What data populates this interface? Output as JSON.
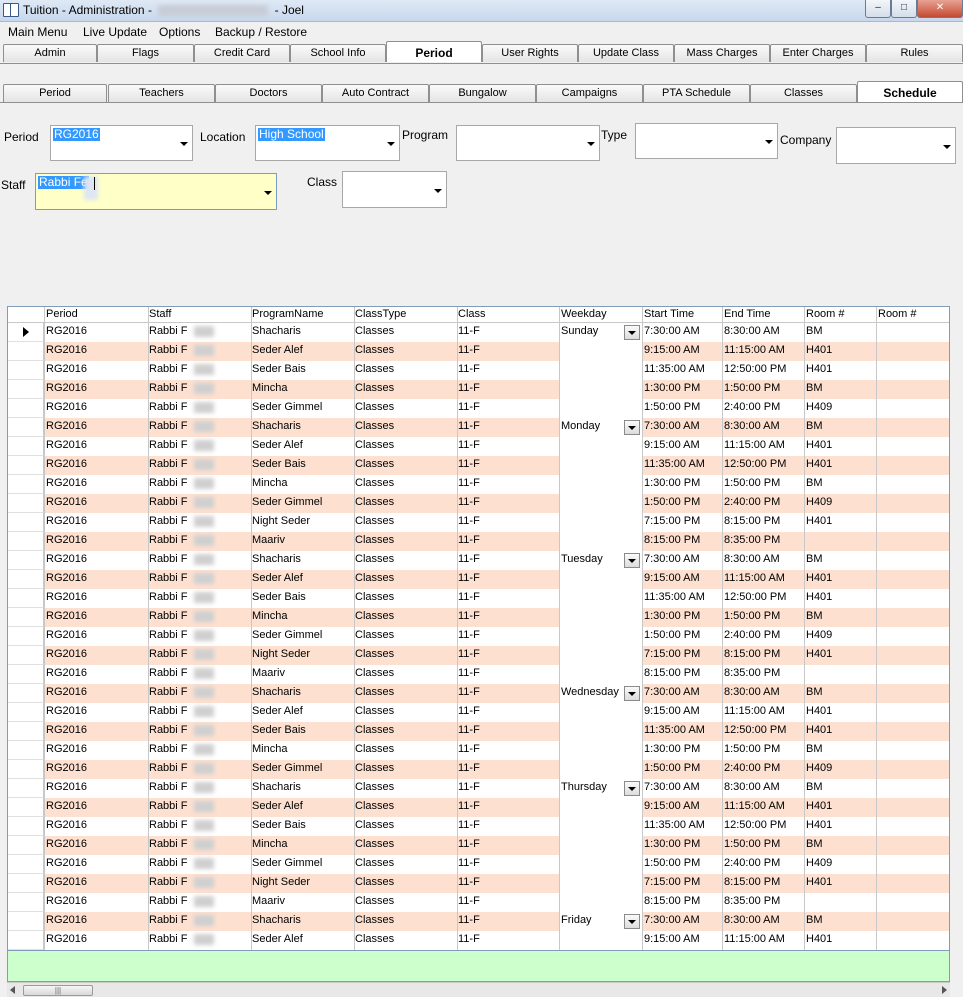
{
  "window": {
    "title_left": "Tuition - Administration - ",
    "title_right": " - Joel"
  },
  "menu": [
    "Main Menu",
    "Live Update",
    "Options",
    "Backup / Restore"
  ],
  "main_tabs": [
    "Admin",
    "Flags",
    "Credit Card",
    "School Info",
    "Period",
    "User Rights",
    "Update Class",
    "Mass Charges",
    "Enter Charges",
    "Rules"
  ],
  "main_tab_active": "Period",
  "sub_tabs": [
    "Period",
    "Teachers",
    "Doctors",
    "Auto Contract",
    "Bungalow",
    "Campaigns",
    "PTA Schedule",
    "Classes",
    "Schedule"
  ],
  "sub_tab_active": "Schedule",
  "filters": {
    "period_label": "Period",
    "period_value": "RG2016",
    "location_label": "Location",
    "location_value": "High School",
    "program_label": "Program",
    "program_value": "",
    "type_label": "Type",
    "type_value": "",
    "company_label": "Company",
    "company_value": "",
    "staff_label": "Staff",
    "staff_value": "Rabbi Fe",
    "class_label": "Class",
    "class_value": ""
  },
  "grid": {
    "columns": [
      "Period",
      "Staff",
      "ProgramName",
      "ClassType",
      "Class",
      "Weekday",
      "Start Time",
      "End Time",
      "Room #",
      "Room #"
    ],
    "rows": [
      {
        "period": "RG2016",
        "staff": "Rabbi F",
        "program": "Shacharis",
        "classtype": "Classes",
        "class": "11-F",
        "weekday": "Sunday",
        "start": "7:30:00 AM",
        "end": "8:30:00 AM",
        "room": "BM"
      },
      {
        "period": "RG2016",
        "staff": "Rabbi F",
        "program": "Seder Alef",
        "classtype": "Classes",
        "class": "11-F",
        "weekday": "",
        "start": "9:15:00 AM",
        "end": "11:15:00 AM",
        "room": "H401"
      },
      {
        "period": "RG2016",
        "staff": "Rabbi F",
        "program": "Seder Bais",
        "classtype": "Classes",
        "class": "11-F",
        "weekday": "",
        "start": "11:35:00 AM",
        "end": "12:50:00 PM",
        "room": "H401"
      },
      {
        "period": "RG2016",
        "staff": "Rabbi F",
        "program": "Mincha",
        "classtype": "Classes",
        "class": "11-F",
        "weekday": "",
        "start": "1:30:00 PM",
        "end": "1:50:00 PM",
        "room": "BM"
      },
      {
        "period": "RG2016",
        "staff": "Rabbi F",
        "program": "Seder Gimmel",
        "classtype": "Classes",
        "class": "11-F",
        "weekday": "",
        "start": "1:50:00 PM",
        "end": "2:40:00 PM",
        "room": "H409"
      },
      {
        "period": "RG2016",
        "staff": "Rabbi F",
        "program": "Shacharis",
        "classtype": "Classes",
        "class": "11-F",
        "weekday": "Monday",
        "start": "7:30:00 AM",
        "end": "8:30:00 AM",
        "room": "BM"
      },
      {
        "period": "RG2016",
        "staff": "Rabbi F",
        "program": "Seder Alef",
        "classtype": "Classes",
        "class": "11-F",
        "weekday": "",
        "start": "9:15:00 AM",
        "end": "11:15:00 AM",
        "room": "H401"
      },
      {
        "period": "RG2016",
        "staff": "Rabbi F",
        "program": "Seder Bais",
        "classtype": "Classes",
        "class": "11-F",
        "weekday": "",
        "start": "11:35:00 AM",
        "end": "12:50:00 PM",
        "room": "H401"
      },
      {
        "period": "RG2016",
        "staff": "Rabbi F",
        "program": "Mincha",
        "classtype": "Classes",
        "class": "11-F",
        "weekday": "",
        "start": "1:30:00 PM",
        "end": "1:50:00 PM",
        "room": "BM"
      },
      {
        "period": "RG2016",
        "staff": "Rabbi F",
        "program": "Seder Gimmel",
        "classtype": "Classes",
        "class": "11-F",
        "weekday": "",
        "start": "1:50:00 PM",
        "end": "2:40:00 PM",
        "room": "H409"
      },
      {
        "period": "RG2016",
        "staff": "Rabbi F",
        "program": "Night Seder",
        "classtype": "Classes",
        "class": "11-F",
        "weekday": "",
        "start": "7:15:00 PM",
        "end": "8:15:00 PM",
        "room": "H401"
      },
      {
        "period": "RG2016",
        "staff": "Rabbi F",
        "program": "Maariv",
        "classtype": "Classes",
        "class": "11-F",
        "weekday": "",
        "start": "8:15:00 PM",
        "end": "8:35:00 PM",
        "room": ""
      },
      {
        "period": "RG2016",
        "staff": "Rabbi F",
        "program": "Shacharis",
        "classtype": "Classes",
        "class": "11-F",
        "weekday": "Tuesday",
        "start": "7:30:00 AM",
        "end": "8:30:00 AM",
        "room": "BM"
      },
      {
        "period": "RG2016",
        "staff": "Rabbi F",
        "program": "Seder Alef",
        "classtype": "Classes",
        "class": "11-F",
        "weekday": "",
        "start": "9:15:00 AM",
        "end": "11:15:00 AM",
        "room": "H401"
      },
      {
        "period": "RG2016",
        "staff": "Rabbi F",
        "program": "Seder Bais",
        "classtype": "Classes",
        "class": "11-F",
        "weekday": "",
        "start": "11:35:00 AM",
        "end": "12:50:00 PM",
        "room": "H401"
      },
      {
        "period": "RG2016",
        "staff": "Rabbi F",
        "program": "Mincha",
        "classtype": "Classes",
        "class": "11-F",
        "weekday": "",
        "start": "1:30:00 PM",
        "end": "1:50:00 PM",
        "room": "BM"
      },
      {
        "period": "RG2016",
        "staff": "Rabbi F",
        "program": "Seder Gimmel",
        "classtype": "Classes",
        "class": "11-F",
        "weekday": "",
        "start": "1:50:00 PM",
        "end": "2:40:00 PM",
        "room": "H409"
      },
      {
        "period": "RG2016",
        "staff": "Rabbi F",
        "program": "Night Seder",
        "classtype": "Classes",
        "class": "11-F",
        "weekday": "",
        "start": "7:15:00 PM",
        "end": "8:15:00 PM",
        "room": "H401"
      },
      {
        "period": "RG2016",
        "staff": "Rabbi F",
        "program": "Maariv",
        "classtype": "Classes",
        "class": "11-F",
        "weekday": "",
        "start": "8:15:00 PM",
        "end": "8:35:00 PM",
        "room": ""
      },
      {
        "period": "RG2016",
        "staff": "Rabbi F",
        "program": "Shacharis",
        "classtype": "Classes",
        "class": "11-F",
        "weekday": "Wednesday",
        "start": "7:30:00 AM",
        "end": "8:30:00 AM",
        "room": "BM"
      },
      {
        "period": "RG2016",
        "staff": "Rabbi F",
        "program": "Seder Alef",
        "classtype": "Classes",
        "class": "11-F",
        "weekday": "",
        "start": "9:15:00 AM",
        "end": "11:15:00 AM",
        "room": "H401"
      },
      {
        "period": "RG2016",
        "staff": "Rabbi F",
        "program": "Seder Bais",
        "classtype": "Classes",
        "class": "11-F",
        "weekday": "",
        "start": "11:35:00 AM",
        "end": "12:50:00 PM",
        "room": "H401"
      },
      {
        "period": "RG2016",
        "staff": "Rabbi F",
        "program": "Mincha",
        "classtype": "Classes",
        "class": "11-F",
        "weekday": "",
        "start": "1:30:00 PM",
        "end": "1:50:00 PM",
        "room": "BM"
      },
      {
        "period": "RG2016",
        "staff": "Rabbi F",
        "program": "Seder Gimmel",
        "classtype": "Classes",
        "class": "11-F",
        "weekday": "",
        "start": "1:50:00 PM",
        "end": "2:40:00 PM",
        "room": "H409"
      },
      {
        "period": "RG2016",
        "staff": "Rabbi F",
        "program": "Shacharis",
        "classtype": "Classes",
        "class": "11-F",
        "weekday": "Thursday",
        "start": "7:30:00 AM",
        "end": "8:30:00 AM",
        "room": "BM"
      },
      {
        "period": "RG2016",
        "staff": "Rabbi F",
        "program": "Seder Alef",
        "classtype": "Classes",
        "class": "11-F",
        "weekday": "",
        "start": "9:15:00 AM",
        "end": "11:15:00 AM",
        "room": "H401"
      },
      {
        "period": "RG2016",
        "staff": "Rabbi F",
        "program": "Seder Bais",
        "classtype": "Classes",
        "class": "11-F",
        "weekday": "",
        "start": "11:35:00 AM",
        "end": "12:50:00 PM",
        "room": "H401"
      },
      {
        "period": "RG2016",
        "staff": "Rabbi F",
        "program": "Mincha",
        "classtype": "Classes",
        "class": "11-F",
        "weekday": "",
        "start": "1:30:00 PM",
        "end": "1:50:00 PM",
        "room": "BM"
      },
      {
        "period": "RG2016",
        "staff": "Rabbi F",
        "program": "Seder Gimmel",
        "classtype": "Classes",
        "class": "11-F",
        "weekday": "",
        "start": "1:50:00 PM",
        "end": "2:40:00 PM",
        "room": "H409"
      },
      {
        "period": "RG2016",
        "staff": "Rabbi F",
        "program": "Night Seder",
        "classtype": "Classes",
        "class": "11-F",
        "weekday": "",
        "start": "7:15:00 PM",
        "end": "8:15:00 PM",
        "room": "H401"
      },
      {
        "period": "RG2016",
        "staff": "Rabbi F",
        "program": "Maariv",
        "classtype": "Classes",
        "class": "11-F",
        "weekday": "",
        "start": "8:15:00 PM",
        "end": "8:35:00 PM",
        "room": ""
      },
      {
        "period": "RG2016",
        "staff": "Rabbi F",
        "program": "Shacharis",
        "classtype": "Classes",
        "class": "11-F",
        "weekday": "Friday",
        "start": "7:30:00 AM",
        "end": "8:30:00 AM",
        "room": "BM"
      },
      {
        "period": "RG2016",
        "staff": "Rabbi F",
        "program": "Seder Alef",
        "classtype": "Classes",
        "class": "11-F",
        "weekday": "",
        "start": "9:15:00 AM",
        "end": "11:15:00 AM",
        "room": "H401"
      }
    ]
  },
  "colors": {
    "alt_row": "#fde0d0",
    "footer_band": "#ccffcc",
    "selection": "#3399ff",
    "staff_input": "#ffffc8"
  },
  "icons": {
    "app": "book-icon",
    "row_indicator": "current-row-arrow-icon",
    "dropdown": "chevron-down-icon"
  }
}
